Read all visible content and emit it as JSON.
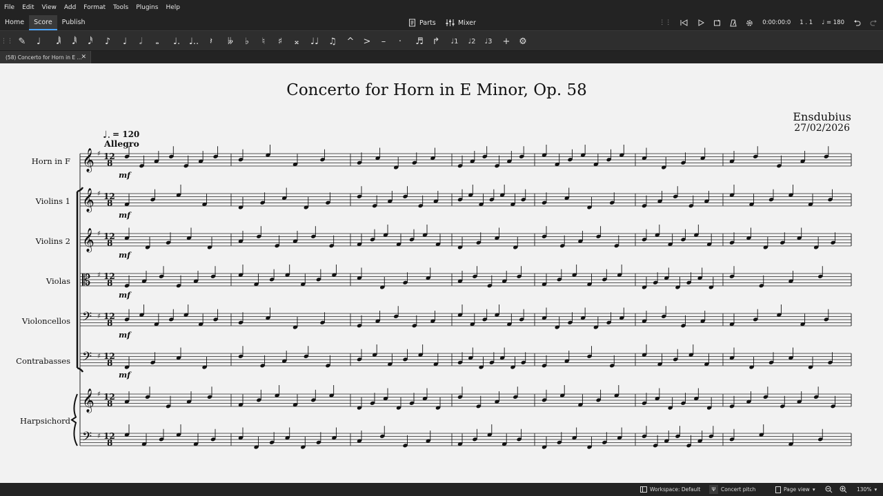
{
  "menubar": {
    "items": [
      "File",
      "Edit",
      "View",
      "Add",
      "Format",
      "Tools",
      "Plugins",
      "Help"
    ]
  },
  "nav": {
    "home": "Home",
    "score": "Score",
    "publish": "Publish",
    "parts": "Parts",
    "mixer": "Mixer"
  },
  "playback": {
    "time": "0:00:00:0",
    "position": "1 . 1",
    "tempo": "= 180"
  },
  "toolbar_icons": [
    "input-mode-icon",
    "toggle-input-icon",
    "64th-note-icon",
    "32nd-note-icon",
    "16th-note-icon",
    "eighth-note-icon",
    "quarter-note-icon",
    "half-note-icon",
    "whole-note-icon",
    "augmentation-dot-icon",
    "double-dot-icon",
    "rest-icon",
    "double-flat-icon",
    "flat-icon",
    "natural-icon",
    "sharp-icon",
    "double-sharp-icon",
    "tie-icon",
    "slur-icon",
    "marcato-icon",
    "accent-icon",
    "tenuto-icon",
    "staccato-icon",
    "tuplet-icon",
    "flip-direction-icon",
    "voice-1-icon",
    "voice-2-icon",
    "voice-3-icon",
    "add-icon",
    "customize-toolbar-icon"
  ],
  "document_tab": {
    "title": "(58) Concerto for Horn in E ..."
  },
  "score": {
    "title": "Concerto for Horn in E Minor, Op. 58",
    "composer": "Ensdubius",
    "date": "27/02/2026",
    "tempo": "= 120",
    "tempo_text": "Allegro",
    "time_signature": "12/8",
    "key_signature": "E minor (1 sharp)",
    "dynamic": "mf",
    "instruments": [
      "Horn in F",
      "Violins 1",
      "Violins 2",
      "Violas",
      "Violoncellos",
      "Contrabasses",
      "Harpsichord"
    ]
  },
  "status": {
    "workspace": "Workspace: Default",
    "concert_pitch": "Concert pitch",
    "view": "Page view",
    "zoom": "130%"
  },
  "colors": {
    "accent": "#4aa3ff",
    "paper": "#f2f2f2",
    "chrome": "#232323"
  }
}
